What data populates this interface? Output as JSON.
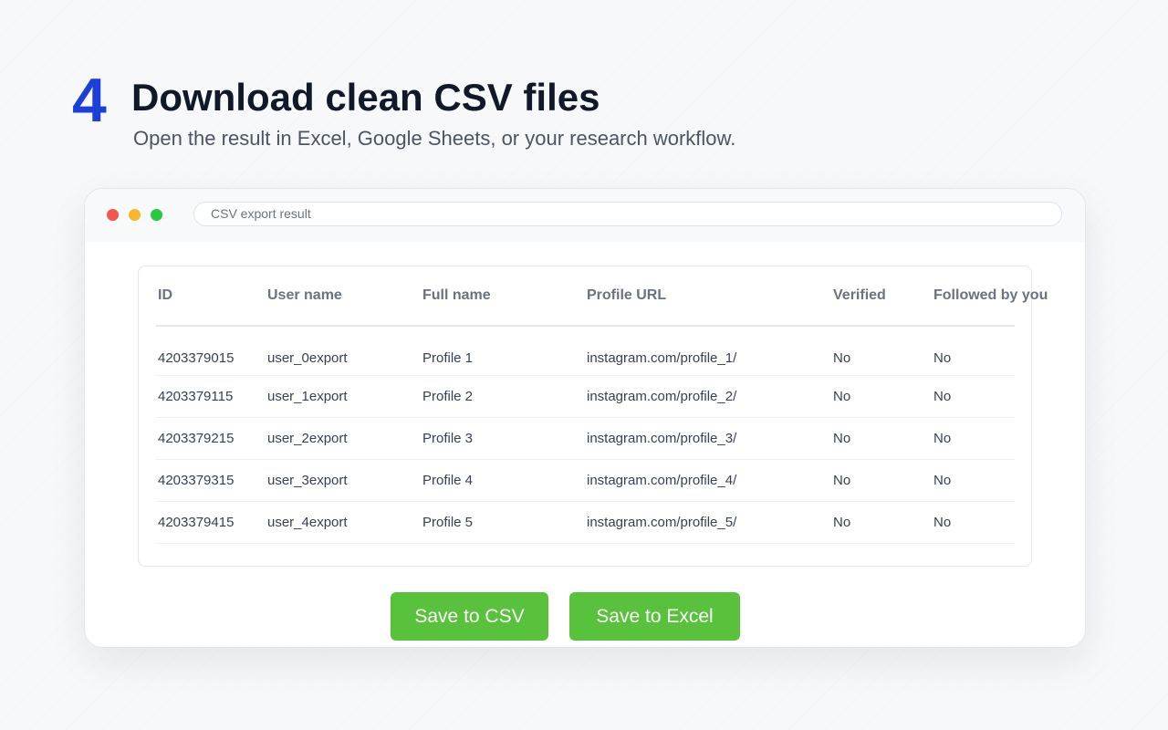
{
  "header": {
    "step_number": "4",
    "title": "Download clean CSV files",
    "subtitle": "Open the result in Excel, Google Sheets, or your research workflow."
  },
  "window": {
    "address_bar": "CSV export result"
  },
  "table": {
    "columns": [
      "ID",
      "User name",
      "Full name",
      "Profile URL",
      "Verified",
      "Followed by you"
    ],
    "rows": [
      [
        "4203379015",
        "user_0export",
        "Profile 1",
        "instagram.com/profile_1/",
        "No",
        "No"
      ],
      [
        "4203379115",
        "user_1export",
        "Profile 2",
        "instagram.com/profile_2/",
        "No",
        "No"
      ],
      [
        "4203379215",
        "user_2export",
        "Profile 3",
        "instagram.com/profile_3/",
        "No",
        "No"
      ],
      [
        "4203379315",
        "user_3export",
        "Profile 4",
        "instagram.com/profile_4/",
        "No",
        "No"
      ],
      [
        "4203379415",
        "user_4export",
        "Profile 5",
        "instagram.com/profile_5/",
        "No",
        "No"
      ]
    ]
  },
  "actions": {
    "save_csv": "Save to CSV",
    "save_excel": "Save to Excel"
  },
  "colors": {
    "accent_blue": "#1c3fd9",
    "button_green": "#58c23c",
    "dot_red": "#f2564c",
    "dot_yellow": "#f8b72c",
    "dot_green": "#27c93f"
  }
}
